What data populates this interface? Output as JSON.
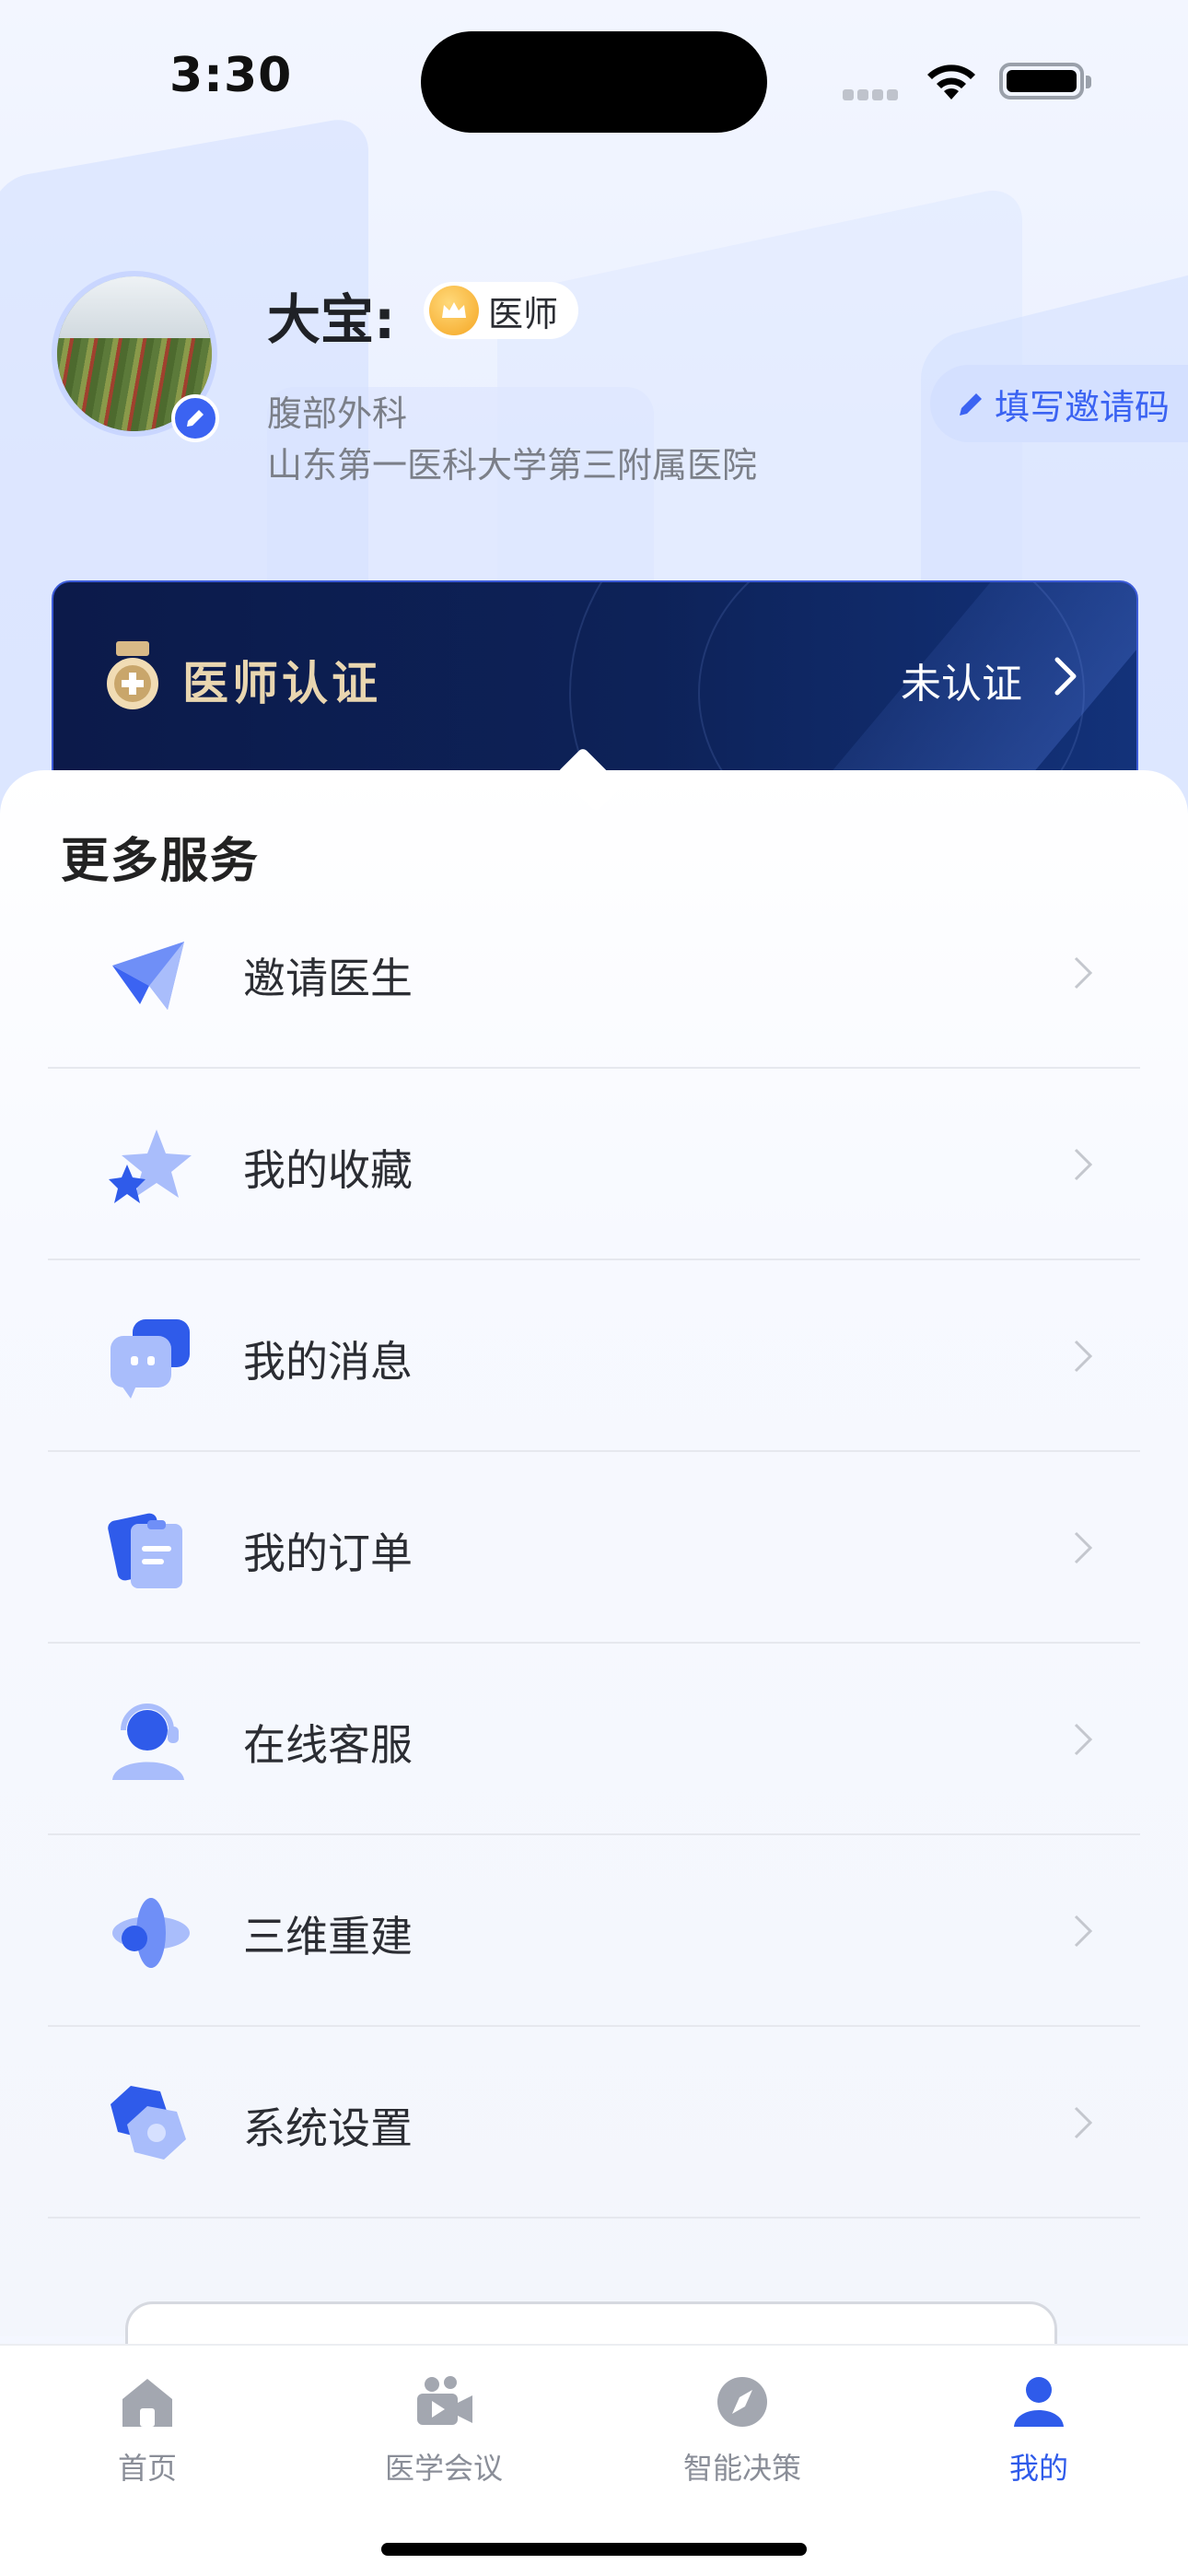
{
  "status_bar": {
    "time": "3:30"
  },
  "profile": {
    "name": "大宝:",
    "role": "医师",
    "department": "腹部外科",
    "hospital": "山东第一医科大学第三附属医院",
    "invite_code_label": "填写邀请码"
  },
  "certification": {
    "title": "医师认证",
    "status": "未认证"
  },
  "services": {
    "title": "更多服务",
    "items": [
      {
        "label": "邀请医生",
        "icon": "paper-plane-icon"
      },
      {
        "label": "我的收藏",
        "icon": "star-icon"
      },
      {
        "label": "我的消息",
        "icon": "chat-bubble-icon"
      },
      {
        "label": "我的订单",
        "icon": "clipboard-icon"
      },
      {
        "label": "在线客服",
        "icon": "headset-agent-icon"
      },
      {
        "label": "三维重建",
        "icon": "3d-sphere-icon"
      },
      {
        "label": "系统设置",
        "icon": "hexagon-gear-icon"
      }
    ]
  },
  "tab_bar": {
    "tabs": [
      {
        "label": "首页",
        "icon": "home-icon",
        "active": false
      },
      {
        "label": "医学会议",
        "icon": "video-camera-icon",
        "active": false
      },
      {
        "label": "智能决策",
        "icon": "compass-icon",
        "active": false
      },
      {
        "label": "我的",
        "icon": "user-icon",
        "active": true
      }
    ]
  },
  "colors": {
    "accent": "#2f5bea",
    "cert_card_bg": "#0d2258",
    "cert_title": "#e9d6b0",
    "inactive_tab": "#8a8e98"
  }
}
